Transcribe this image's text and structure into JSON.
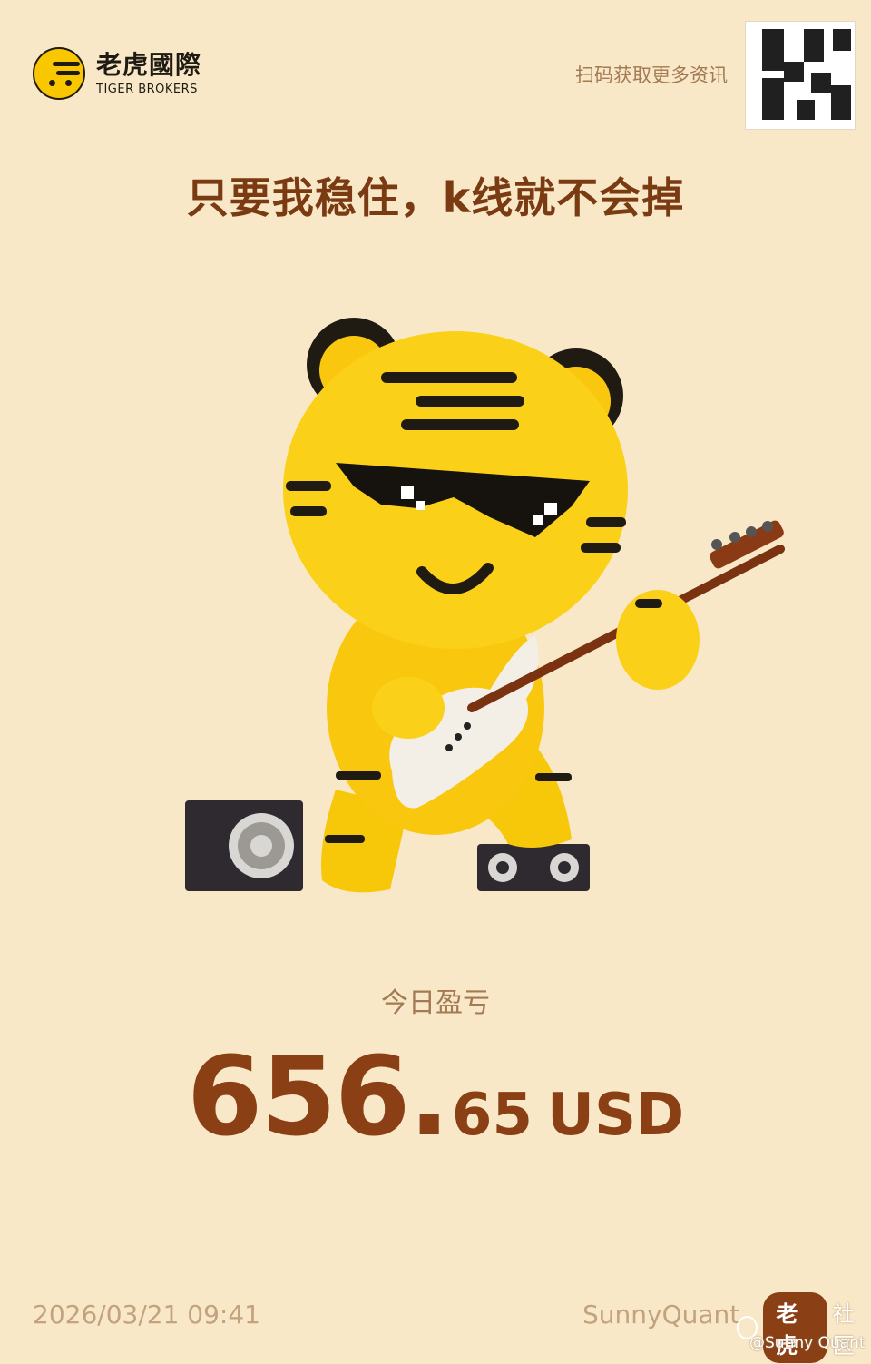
{
  "brand": {
    "name_cn": "老虎國際",
    "name_en": "TIGER BROKERS"
  },
  "header": {
    "scan_prompt": "扫码获取更多资讯"
  },
  "headline": "只要我稳住，k线就不会掉",
  "pnl": {
    "label": "今日盈亏",
    "integer": "656",
    "dot": ".",
    "decimal": "65",
    "currency": "USD"
  },
  "footer": {
    "datetime": "2026/03/21 09:41",
    "username": "SunnyQuant"
  },
  "watermark": {
    "badge": "老虎",
    "community": "社区",
    "handle": "@Sunny Quant"
  },
  "colors": {
    "background": "#f8e8c8",
    "accent": "#8a3f14",
    "muted": "#a37a52",
    "tiger_yellow": "#f9c700"
  }
}
